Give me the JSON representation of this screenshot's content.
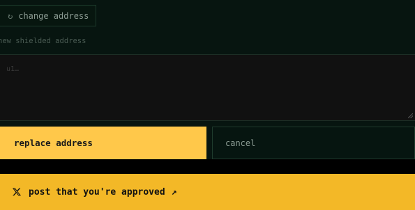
{
  "change_button": {
    "icon": "refresh-icon",
    "icon_glyph": "↻",
    "label": "change address"
  },
  "address_field": {
    "label": "new shielded address",
    "placeholder": "u1…",
    "value": ""
  },
  "actions": {
    "replace_label": "replace address",
    "cancel_label": "cancel"
  },
  "share": {
    "icon": "x-logo-icon",
    "label": "post that you're approved",
    "arrow_icon": "external-arrow-icon",
    "arrow_glyph": "↗"
  },
  "colors": {
    "primary_yellow": "#ffc84a",
    "share_yellow": "#f3b827",
    "panel_bg": "#071510",
    "page_bg": "#000000"
  }
}
